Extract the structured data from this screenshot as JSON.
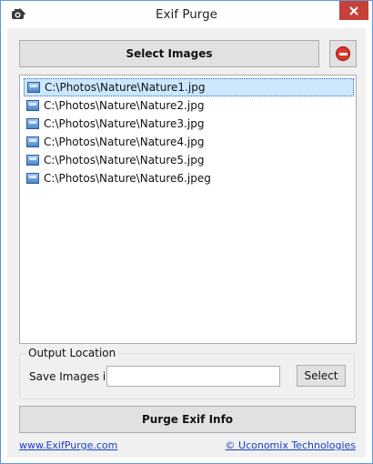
{
  "window": {
    "title": "Exif Purge"
  },
  "toolbar": {
    "select_images_label": "Select Images"
  },
  "files": [
    {
      "path": "C:\\Photos\\Nature\\Nature1.jpg",
      "selected": true
    },
    {
      "path": "C:\\Photos\\Nature\\Nature2.jpg",
      "selected": false
    },
    {
      "path": "C:\\Photos\\Nature\\Nature3.jpg",
      "selected": false
    },
    {
      "path": "C:\\Photos\\Nature\\Nature4.jpg",
      "selected": false
    },
    {
      "path": "C:\\Photos\\Nature\\Nature5.jpg",
      "selected": false
    },
    {
      "path": "C:\\Photos\\Nature\\Nature6.jpeg",
      "selected": false
    }
  ],
  "output": {
    "group_label": "Output Location",
    "save_label": "Save Images in",
    "path_value": "",
    "select_label": "Select"
  },
  "purge_label": "Purge Exif Info",
  "footer": {
    "website": "www.ExifPurge.com",
    "copyright": "© Uconomix Technologies"
  },
  "icons": {
    "app": "app-icon",
    "close": "close-icon",
    "remove": "remove-icon",
    "file": "image-file-icon"
  },
  "colors": {
    "close_button": "#c7403a",
    "remove_icon": "#d9362b",
    "selection": "#cce8ff",
    "link": "#1a3dc4"
  }
}
